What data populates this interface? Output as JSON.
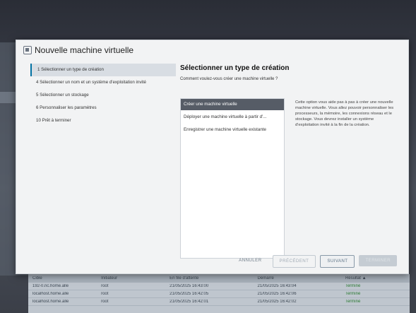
{
  "dialog": {
    "title": "Nouvelle machine virtuelle"
  },
  "steps": [
    {
      "label": "1  Sélectionner un type de création"
    },
    {
      "label": "4  Sélectionner un nom et un système d'exploitation invité"
    },
    {
      "label": "5  Sélectionner un stockage"
    },
    {
      "label": "6  Personnaliser les paramètres"
    },
    {
      "label": "10  Prêt à terminer"
    }
  ],
  "content": {
    "heading": "Sélectionner un type de création",
    "question": "Comment voulez-vous créer une machine virtuelle ?",
    "options": [
      {
        "label": "Créer une machine virtuelle"
      },
      {
        "label": "Déployer une machine virtuelle à partir d'..."
      },
      {
        "label": "Enregistrer une machine virtuelle existante"
      }
    ],
    "description": "Cette option vous aide pas à pas à créer une nouvelle machine virtuelle. Vous allez pouvoir personnaliser les processeurs, la mémoire, les connexions réseau et le stockage. Vous devrez installer un système d'exploitation invité à la fin de la création."
  },
  "footer": {
    "cancel": "ANNULER",
    "previous": "PRÉCÉDENT",
    "next": "SUIVANT",
    "finish": "TERMINER"
  },
  "background_table": {
    "headers": [
      "Cible",
      "Initiateur",
      "En file d'attente",
      "Démarré",
      "Résultat ▲"
    ],
    "rows": [
      [
        "192-0.nc.home.alle",
        "root",
        "21/05/2025 16:43:00",
        "21/05/2025 16:43:04",
        "Terminé"
      ],
      [
        "localhost.home.alle",
        "root",
        "21/05/2025 16:42:05",
        "21/05/2025 16:42:06",
        "Terminé"
      ],
      [
        "localhost.home.alle",
        "root",
        "21/05/2025 16:42:01",
        "21/05/2025 16:42:02",
        "Terminé"
      ]
    ]
  },
  "colors": {
    "accent": "#0072a3",
    "selected_option_bg": "#565c66",
    "modal_bg": "#f2f3f4"
  }
}
